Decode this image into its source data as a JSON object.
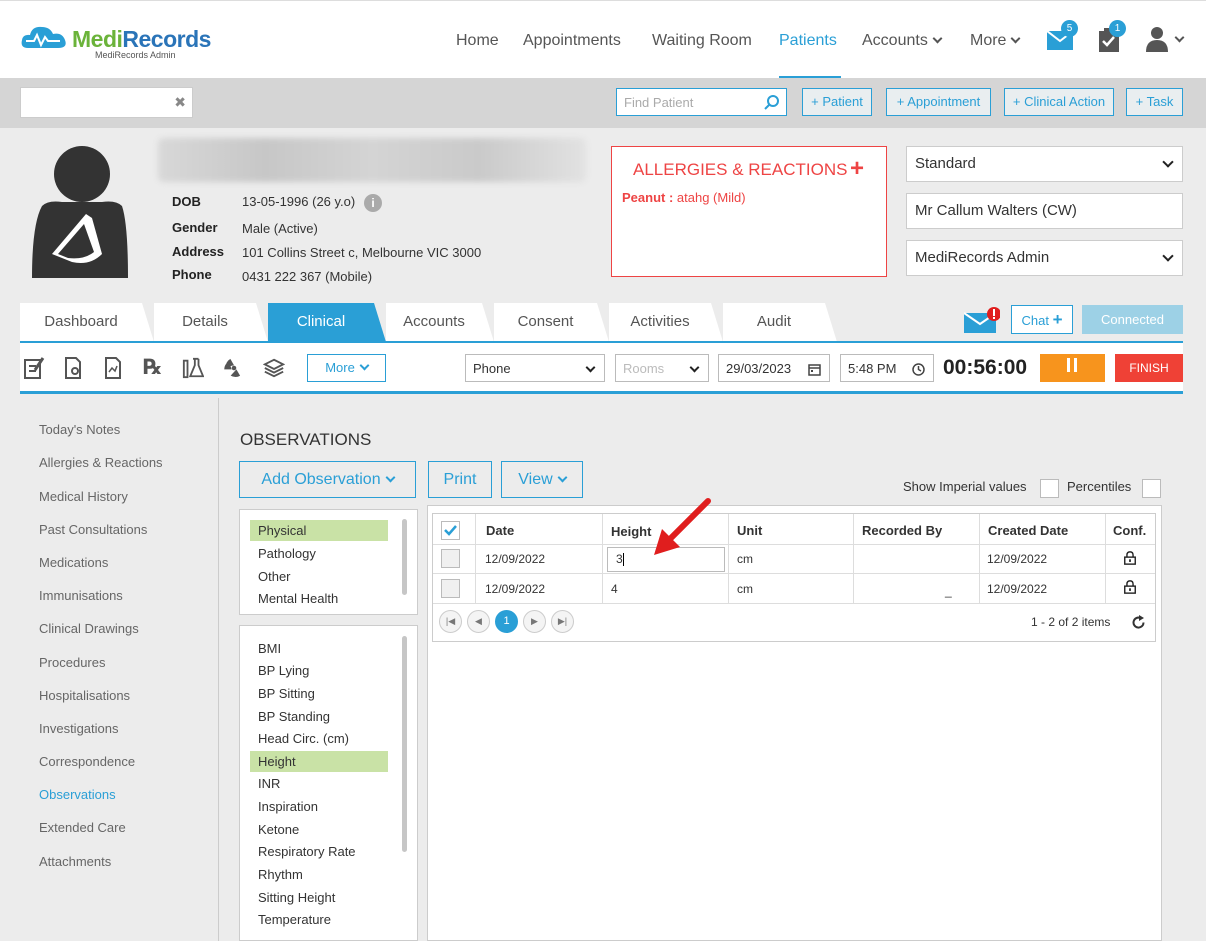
{
  "header": {
    "brand_medi": "Medi",
    "brand_records": "Records",
    "brand_sub": "MediRecords Admin",
    "nav": [
      "Home",
      "Appointments",
      "Waiting Room",
      "Patients",
      "Accounts",
      "More"
    ],
    "active_nav": "Patients",
    "mail_badge": "5",
    "task_badge": "1"
  },
  "search": {
    "find_placeholder": "Find Patient",
    "buttons": [
      "+ Patient",
      "+ Appointment",
      "+ Clinical Action",
      "+ Task"
    ]
  },
  "patient": {
    "labels": {
      "dob": "DOB",
      "gender": "Gender",
      "address": "Address",
      "phone": "Phone"
    },
    "dob": "13-05-1996 (26 y.o)",
    "gender": "Male (Active)",
    "address": "101 Collins Street c, Melbourne VIC 3000",
    "phone": "0431 222 367 (Mobile)"
  },
  "allergies": {
    "title": "ALLERGIES & REACTIONS",
    "item_name": "Peanut :",
    "item_detail": " atahg (Mild)"
  },
  "right_panel": {
    "template": "Standard",
    "practitioner": "Mr Callum Walters (CW)",
    "location": "MediRecords Admin"
  },
  "tabs": [
    "Dashboard",
    "Details",
    "Clinical",
    "Accounts",
    "Consent",
    "Activities",
    "Audit"
  ],
  "active_tab": "Clinical",
  "chat": {
    "label": "Chat",
    "status": "Connected"
  },
  "toolbar": {
    "more": "More",
    "mode": "Phone",
    "rooms_placeholder": "Rooms",
    "date": "29/03/2023",
    "time": "5:48 PM",
    "timer": "00:56:00",
    "finish": "FINISH"
  },
  "sidenav": [
    "Today's Notes",
    "Allergies & Reactions",
    "Medical History",
    "Past Consultations",
    "Medications",
    "Immunisations",
    "Clinical Drawings",
    "Procedures",
    "Hospitalisations",
    "Investigations",
    "Correspondence",
    "Observations",
    "Extended Care",
    "Attachments"
  ],
  "active_sidenav": "Observations",
  "observations": {
    "title": "OBSERVATIONS",
    "add_btn": "Add Observation",
    "print_btn": "Print",
    "view_btn": "View",
    "show_imperial": "Show Imperial values",
    "percentiles": "Percentiles",
    "categories": [
      "Physical",
      "Pathology",
      "Other",
      "Mental Health"
    ],
    "selected_category": "Physical",
    "types": [
      "BMI",
      "BP Lying",
      "BP Sitting",
      "BP Standing",
      "Head Circ. (cm)",
      "Height",
      "INR",
      "Inspiration",
      "Ketone",
      "Respiratory Rate",
      "Rhythm",
      "Sitting Height",
      "Temperature"
    ],
    "selected_type": "Height",
    "columns": [
      "Date",
      "Height",
      "Unit",
      "Recorded By",
      "Created Date",
      "Conf."
    ],
    "rows": [
      {
        "date": "12/09/2022",
        "height": "3",
        "unit": "cm",
        "recorded_by": "",
        "created": "12/09/2022"
      },
      {
        "date": "12/09/2022",
        "height": "4",
        "unit": "cm",
        "recorded_by": "_",
        "created": "12/09/2022"
      }
    ],
    "page": "1",
    "page_info": "1 - 2 of 2 items"
  }
}
